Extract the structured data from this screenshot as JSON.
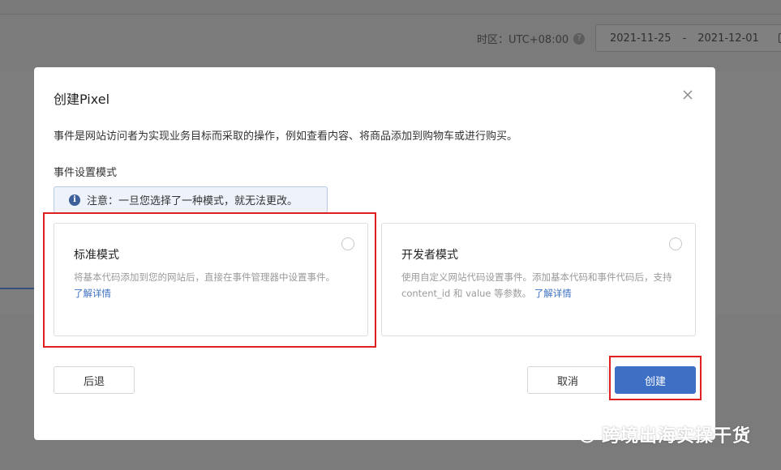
{
  "background": {
    "timezone_label": "时区：UTC+08:00",
    "help_icon": "?",
    "date_start": "2021-11-25",
    "date_sep": "-",
    "date_end": "2021-12-01"
  },
  "modal": {
    "title": "创建Pixel",
    "description": "事件是网站访问者为实现业务目标而采取的操作，例如查看内容、将商品添加到购物车或进行购买。",
    "section_label": "事件设置模式",
    "notice": {
      "icon": "i",
      "text": "注意：一旦您选择了一种模式，就无法更改。"
    },
    "options": [
      {
        "title": "标准模式",
        "text": "将基本代码添加到您的网站后，直接在事件管理器中设置事件。",
        "link": "了解详情"
      },
      {
        "title": "开发者模式",
        "text": "使用自定义网站代码设置事件。添加基本代码和事件代码后，支持 content_id 和 value 等参数。",
        "link": "了解详情"
      }
    ],
    "buttons": {
      "back": "后退",
      "cancel": "取消",
      "create": "创建"
    }
  },
  "colors": {
    "primary": "#3d6fc5",
    "highlight": "#e02020",
    "link": "#3c6fc0"
  },
  "watermark": {
    "text": "跨境出海实操干货",
    "icon": "wechat-icon"
  }
}
